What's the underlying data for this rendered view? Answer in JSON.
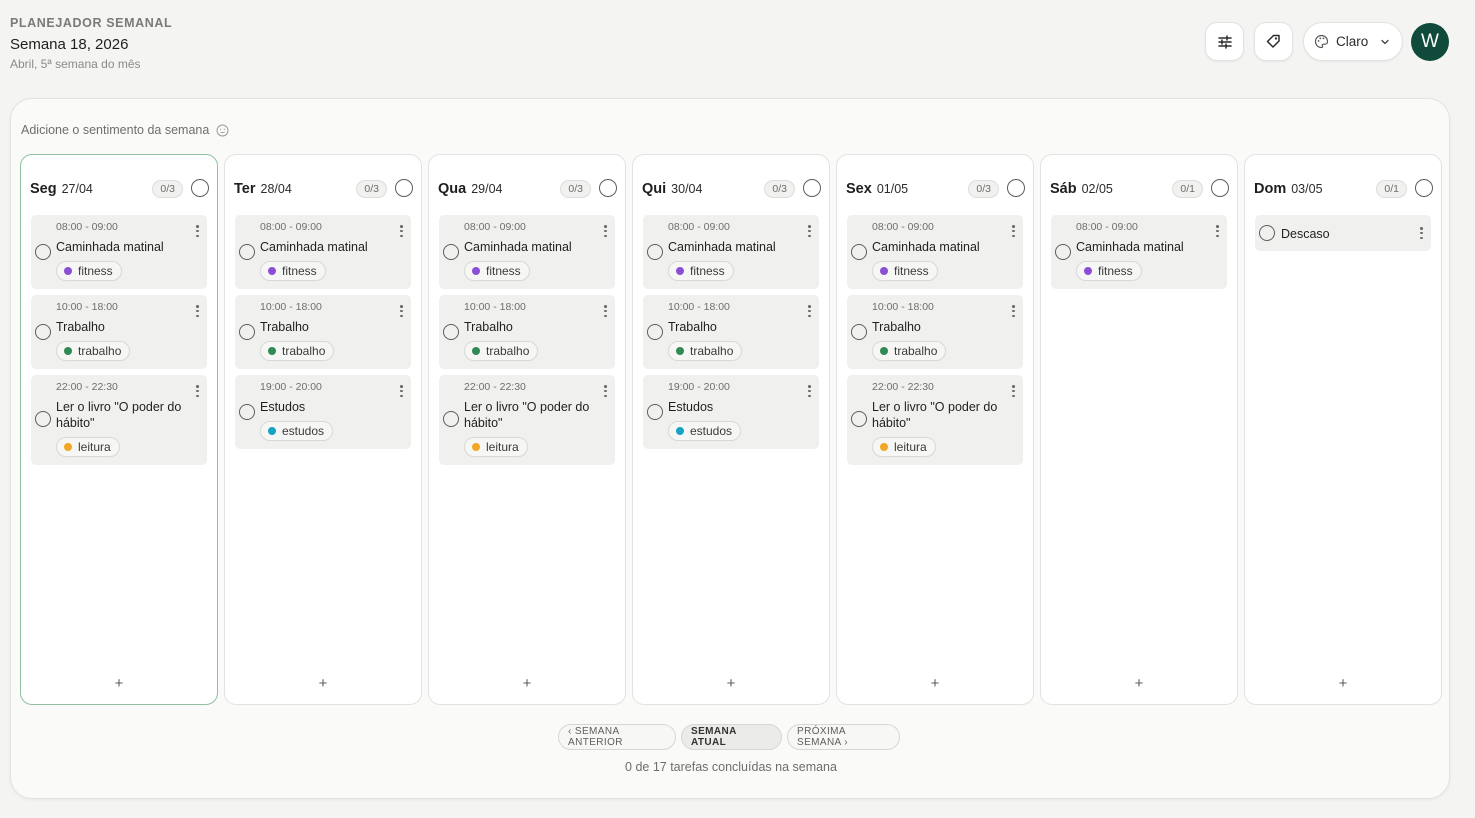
{
  "header": {
    "kicker": "PLANEJADOR SEMANAL",
    "title": "Semana 18, 2026",
    "subtitle": "Abril, 5ª semana do mês"
  },
  "toolbar": {
    "filter_icon": "sliders-icon",
    "tag_icon": "tags-icon",
    "theme_icon": "palette-icon",
    "theme_label": "Claro",
    "avatar_letter": "W",
    "avatar_color": "#0f4a3a"
  },
  "mood": {
    "label": "Adicione o sentimento da semana",
    "icon": "smiley-icon"
  },
  "tag_colors": {
    "fitness": "#8b4fd6",
    "trabalho": "#2f8a55",
    "leitura": "#f5a524",
    "estudos": "#17a3c4"
  },
  "days": [
    {
      "name": "Seg",
      "date": "27/04",
      "count": "0/3",
      "today": true,
      "add": "+",
      "tasks": [
        {
          "time": "08:00 - 09:00",
          "title": "Caminhada matinal",
          "tag": "fitness"
        },
        {
          "time": "10:00 - 18:00",
          "title": "Trabalho",
          "tag": "trabalho"
        },
        {
          "time": "22:00 - 22:30",
          "title": "Ler o livro \"O poder do hábito\"",
          "tag": "leitura"
        }
      ]
    },
    {
      "name": "Ter",
      "date": "28/04",
      "count": "0/3",
      "today": false,
      "add": "+",
      "tasks": [
        {
          "time": "08:00 - 09:00",
          "title": "Caminhada matinal",
          "tag": "fitness"
        },
        {
          "time": "10:00 - 18:00",
          "title": "Trabalho",
          "tag": "trabalho"
        },
        {
          "time": "19:00 - 20:00",
          "title": "Estudos",
          "tag": "estudos"
        }
      ]
    },
    {
      "name": "Qua",
      "date": "29/04",
      "count": "0/3",
      "today": false,
      "add": "+",
      "tasks": [
        {
          "time": "08:00 - 09:00",
          "title": "Caminhada matinal",
          "tag": "fitness"
        },
        {
          "time": "10:00 - 18:00",
          "title": "Trabalho",
          "tag": "trabalho"
        },
        {
          "time": "22:00 - 22:30",
          "title": "Ler o livro \"O poder do hábito\"",
          "tag": "leitura"
        }
      ]
    },
    {
      "name": "Qui",
      "date": "30/04",
      "count": "0/3",
      "today": false,
      "add": "+",
      "tasks": [
        {
          "time": "08:00 - 09:00",
          "title": "Caminhada matinal",
          "tag": "fitness"
        },
        {
          "time": "10:00 - 18:00",
          "title": "Trabalho",
          "tag": "trabalho"
        },
        {
          "time": "19:00 - 20:00",
          "title": "Estudos",
          "tag": "estudos"
        }
      ]
    },
    {
      "name": "Sex",
      "date": "01/05",
      "count": "0/3",
      "today": false,
      "add": "+",
      "tasks": [
        {
          "time": "08:00 - 09:00",
          "title": "Caminhada matinal",
          "tag": "fitness"
        },
        {
          "time": "10:00 - 18:00",
          "title": "Trabalho",
          "tag": "trabalho"
        },
        {
          "time": "22:00 - 22:30",
          "title": "Ler o livro \"O poder do hábito\"",
          "tag": "leitura"
        }
      ]
    },
    {
      "name": "Sáb",
      "date": "02/05",
      "count": "0/1",
      "today": false,
      "add": "+",
      "tasks": [
        {
          "time": "08:00 - 09:00",
          "title": "Caminhada matinal",
          "tag": "fitness"
        }
      ]
    },
    {
      "name": "Dom",
      "date": "03/05",
      "count": "0/1",
      "today": false,
      "add": "+",
      "tasks": [
        {
          "time": "",
          "title": "Descaso",
          "tag": ""
        }
      ]
    }
  ],
  "nav": {
    "prev": "‹ SEMANA ANTERIOR",
    "current": "SEMANA ATUAL",
    "next": "PRÓXIMA SEMANA ›"
  },
  "summary": "0 de 17 tarefas concluídas na semana"
}
